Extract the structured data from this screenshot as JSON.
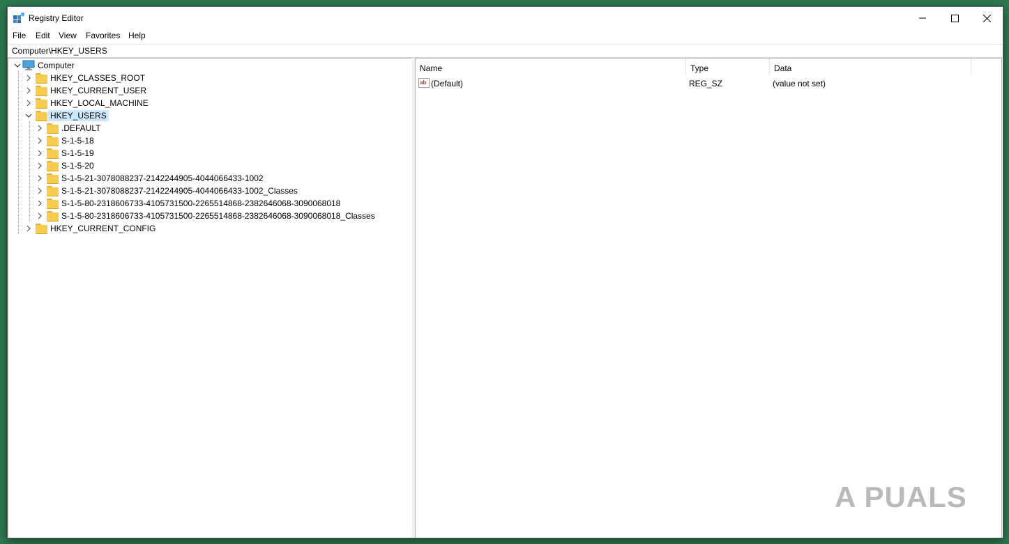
{
  "window": {
    "title": "Registry Editor"
  },
  "menu": [
    "File",
    "Edit",
    "View",
    "Favorites",
    "Help"
  ],
  "address": "Computer\\HKEY_USERS",
  "tree": {
    "root": "Computer",
    "hives": [
      "HKEY_CLASSES_ROOT",
      "HKEY_CURRENT_USER",
      "HKEY_LOCAL_MACHINE",
      "HKEY_USERS",
      "HKEY_CURRENT_CONFIG"
    ],
    "users_children": [
      ".DEFAULT",
      "S-1-5-18",
      "S-1-5-19",
      "S-1-5-20",
      "S-1-5-21-3078088237-2142244905-4044066433-1002",
      "S-1-5-21-3078088237-2142244905-4044066433-1002_Classes",
      "S-1-5-80-2318606733-4105731500-2265514868-2382646068-3090068018",
      "S-1-5-80-2318606733-4105731500-2265514868-2382646068-3090068018_Classes"
    ]
  },
  "columns": {
    "name": "Name",
    "type": "Type",
    "data": "Data"
  },
  "values": [
    {
      "name": "(Default)",
      "type": "REG_SZ",
      "data": "(value not set)",
      "icon": "string-value-icon"
    }
  ],
  "watermark": "A  PUALS"
}
